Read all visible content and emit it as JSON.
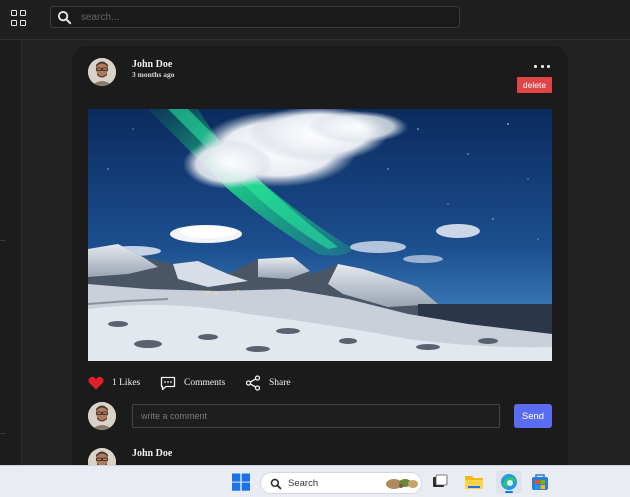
{
  "topbar": {
    "search_placeholder": "search..."
  },
  "post": {
    "author": "John Doe",
    "time": "3 months ago",
    "delete_label": "delete",
    "image_alt": "Aurora borealis over snowy mountains",
    "likes_label": "1 Likes",
    "liked": true,
    "comments_label": "Comments",
    "share_label": "Share",
    "comment_placeholder": "write a comment",
    "send_label": "Send"
  },
  "comments": [
    {
      "author": "John Doe"
    }
  ],
  "taskbar": {
    "search_label": "Search"
  },
  "colors": {
    "background": "#222222",
    "card": "#1b1b1b",
    "delete": "#e04545",
    "send": "#5a6df0",
    "heart": "#e0202a",
    "taskbar": "#e9edf3"
  },
  "icons": [
    "grid-icon",
    "search-icon",
    "more-dots-icon",
    "heart-icon",
    "comment-icon",
    "share-icon",
    "windows-start-icon",
    "task-view-icon",
    "file-explorer-icon",
    "edge-icon",
    "store-icon"
  ]
}
